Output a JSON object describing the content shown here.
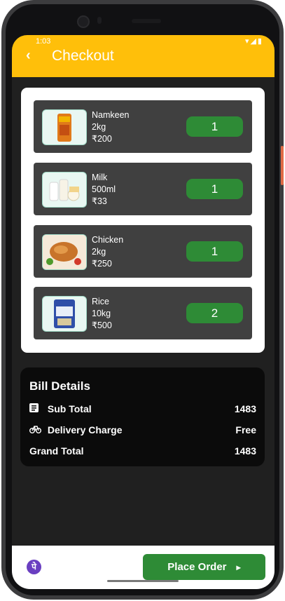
{
  "status_bar": {
    "time": "1:03",
    "icons": "▾◢▮"
  },
  "header": {
    "back_icon": "‹",
    "title": "Checkout"
  },
  "cart_items": [
    {
      "name": "Namkeen",
      "qty_text": "2kg",
      "price": "₹200",
      "count": "1",
      "image": "snack-pack"
    },
    {
      "name": "Milk",
      "qty_text": "500ml",
      "price": "₹33",
      "count": "1",
      "image": "dairy-products"
    },
    {
      "name": "Chicken",
      "qty_text": "2kg",
      "price": "₹250",
      "count": "1",
      "image": "roast-chicken"
    },
    {
      "name": "Rice",
      "qty_text": "10kg",
      "price": "₹500",
      "count": "2",
      "image": "rice-bag"
    }
  ],
  "bill": {
    "title": "Bill Details",
    "sub_total_label": "Sub Total",
    "sub_total_value": "1483",
    "delivery_label": "Delivery Charge",
    "delivery_value": "Free",
    "grand_total_label": "Grand Total",
    "grand_total_value": "1483"
  },
  "footer": {
    "pay_icon_text": "पे",
    "place_order_label": "Place Order",
    "arrow": "▸"
  },
  "colors": {
    "accent": "#ffbf0a",
    "button": "#2e8b36",
    "background": "#202020"
  }
}
